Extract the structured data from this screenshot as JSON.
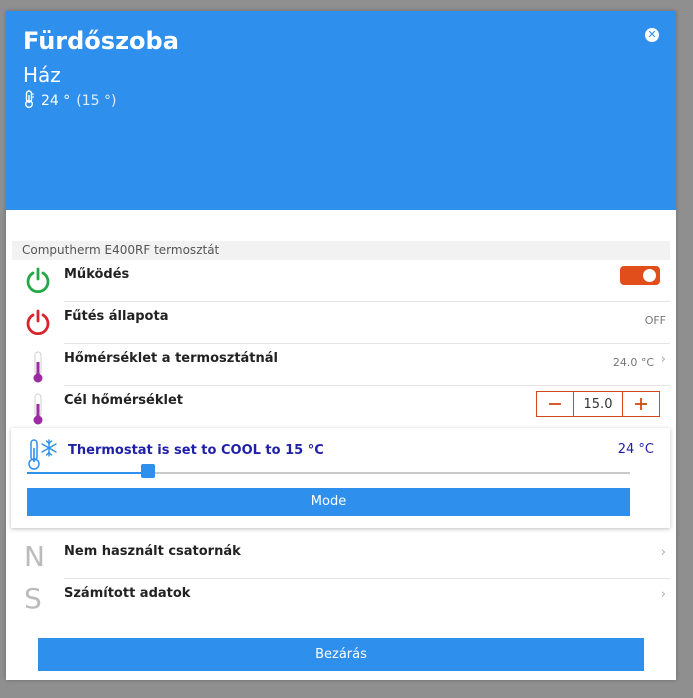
{
  "header": {
    "room": "Fürdőszoba",
    "house": "Ház",
    "temp": "24 °",
    "temp_sub": "(15 °)",
    "close_glyph": "✕"
  },
  "device": {
    "name": "Computherm E400RF termosztát"
  },
  "rows": {
    "working": {
      "label": "Működés",
      "state": "on"
    },
    "heating": {
      "label": "Fűtés állapota",
      "value": "OFF"
    },
    "thermostat_temp": {
      "label": "Hőmérséklet a termosztátnál",
      "value": "24.0 °C"
    },
    "target_temp": {
      "label": "Cél hőmérséklet",
      "value": "15.0"
    }
  },
  "cool_card": {
    "text": "Thermostat is set to COOL to 15 °C",
    "temp": "24 °C",
    "slider_fraction": 0.2,
    "mode_label": "Mode"
  },
  "extra": {
    "unused": {
      "letter": "N",
      "label": "Nem használt csatornák"
    },
    "computed": {
      "letter": "S",
      "label": "Számított adatok"
    }
  },
  "footer": {
    "close_label": "Bezárás"
  },
  "colors": {
    "accent": "#2f8fec",
    "toggle_on": "#e24e1b",
    "power_green": "#22a844",
    "power_red": "#d8242c",
    "cool_text": "#1f1fa8"
  },
  "icons": {
    "header_temp": "thermometer-icon",
    "working": "power-icon",
    "heating": "power-icon",
    "thermostat_temp": "thermometer-icon",
    "target_temp": "thermometer-icon",
    "cool": "snowflake-thermometer-icon"
  }
}
